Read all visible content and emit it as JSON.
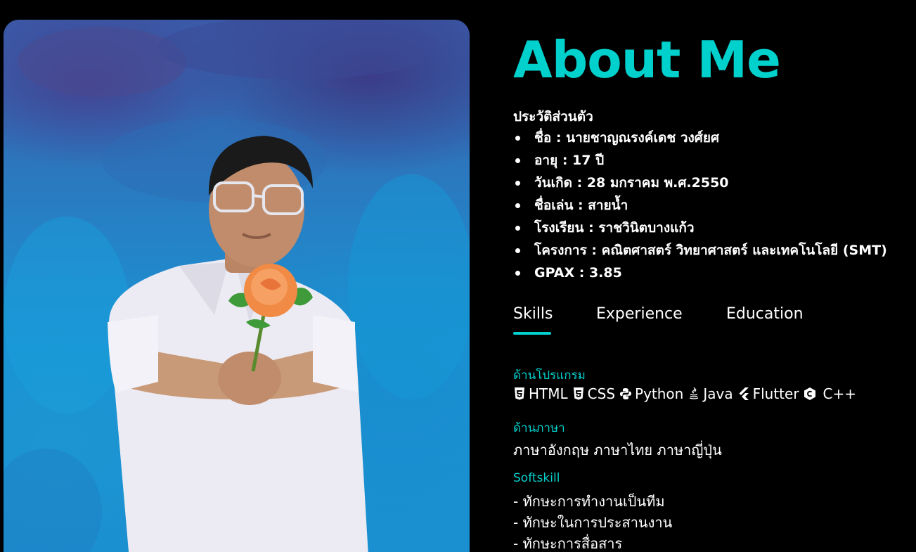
{
  "about": {
    "title": "About Me",
    "bio_heading": "ประวัติส่วนตัว",
    "bio_items": [
      {
        "label": "ชื่อ : นายชาญณรงค์เดช วงศ์ยศ"
      },
      {
        "label": "อายุ : 17 ปี"
      },
      {
        "label": "วันเกิด : 28 มกราคม พ.ศ.2550"
      },
      {
        "label": "ชื่อเล่น : สายน้ำ"
      },
      {
        "label": "โรงเรียน : ราชวินิตบางแก้ว"
      },
      {
        "label": "โครงการ : คณิตศาสตร์ วิทยาศาสตร์ และเทคโนโลยี (SMT)"
      },
      {
        "label": "GPAX : 3.85"
      }
    ]
  },
  "tabs": [
    {
      "label": "Skills",
      "active": true
    },
    {
      "label": "Experience",
      "active": false
    },
    {
      "label": "Education",
      "active": false
    }
  ],
  "skills": {
    "programming_label": "ด้านโปรแกรม",
    "programming": [
      {
        "label": "HTML",
        "icon": "html5-icon"
      },
      {
        "label": "CSS",
        "icon": "css3-icon"
      },
      {
        "label": "Python",
        "icon": "python-icon"
      },
      {
        "label": "Java",
        "icon": "java-icon"
      },
      {
        "label": "Flutter",
        "icon": "flutter-icon"
      },
      {
        "label": "C++",
        "icon": "cplusplus-icon"
      }
    ],
    "language_label": "ด้านภาษา",
    "languages": "ภาษาอังกฤษ ภาษาไทย ภาษาญี่ปุ่น",
    "softskill_label": "Softskill",
    "softskills": [
      "- ทักษะการทำงานเป็นทีม",
      "- ทักษะในการประสานงาน",
      "- ทักษะการสื่อสาร"
    ]
  },
  "colors": {
    "accent": "#00d1cc",
    "background": "#000000",
    "text": "#ffffff"
  }
}
